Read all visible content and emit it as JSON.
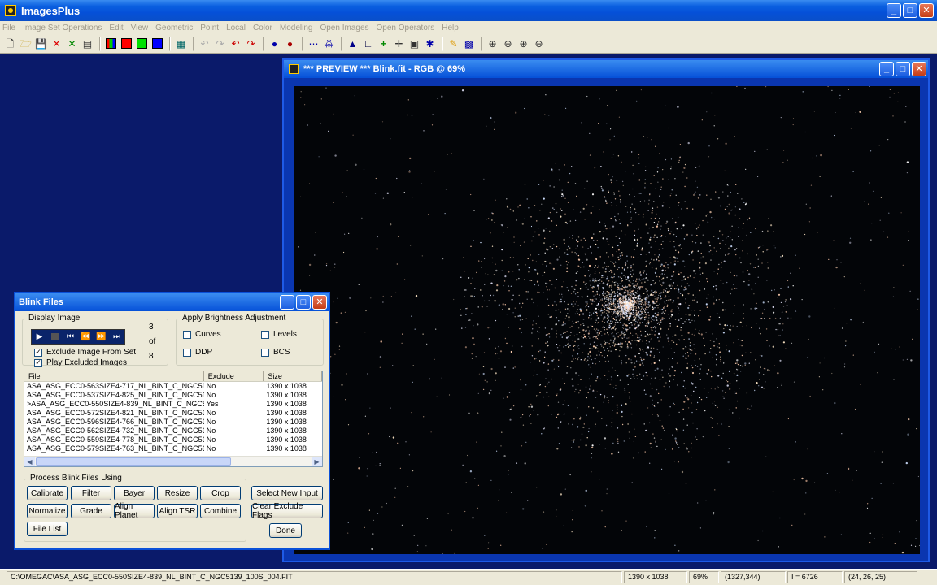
{
  "app": {
    "title": "ImagesPlus"
  },
  "menu": [
    "File",
    "Image Set Operations",
    "Edit",
    "View",
    "Geometric",
    "Point",
    "Local",
    "Color",
    "Modeling",
    "Open Images",
    "Open Operators",
    "Help"
  ],
  "toolbar": {
    "icons": [
      "new-icon",
      "open-icon",
      "save-icon",
      "close-red-icon",
      "close-green-icon",
      "print-icon",
      "rgb-channel-icon",
      "red-channel-icon",
      "green-channel-icon",
      "blue-channel-icon",
      "grid-icon",
      "undo-icon",
      "redo-icon",
      "undo-all-icon",
      "redo-all-icon",
      "point-icon",
      "point-red-icon",
      "dots-icon",
      "star-icon",
      "mountain-icon",
      "angle-icon",
      "plus-icon",
      "crosshair-icon",
      "table-icon",
      "paint-icon",
      "pencil-icon",
      "grid-table-icon",
      "zoom-in-icon",
      "zoom-out-icon",
      "zoom-fit-icon",
      "zoom-actual-icon"
    ],
    "colors": {
      "red": "#ff0000",
      "green": "#00e000",
      "blue": "#0000ff"
    }
  },
  "preview": {
    "title": "*** PREVIEW *** Blink.fit - RGB @ 69%"
  },
  "blink": {
    "title": "Blink Files",
    "display_group": "Display Image",
    "counter": {
      "current": "3",
      "of": "of",
      "total": "8"
    },
    "exclude_label": "Exclude Image From Set",
    "play_excluded_label": "Play Excluded Images",
    "brightness_group": "Apply Brightness Adjustment",
    "curves": "Curves",
    "levels": "Levels",
    "ddp": "DDP",
    "bcs": "BCS",
    "columns": {
      "file": "File",
      "exclude": "Exclude",
      "size": "Size"
    },
    "rows": [
      {
        "file": "ASA_ASG_ECC0-563SIZE4-717_NL_BINT_C_NGC51...",
        "exclude": "No",
        "size": "1390 x 1038"
      },
      {
        "file": "ASA_ASG_ECC0-537SIZE4-825_NL_BINT_C_NGC51...",
        "exclude": "No",
        "size": "1390 x 1038"
      },
      {
        "file": ">ASA_ASG_ECC0-550SIZE4-839_NL_BINT_C_NGC5...",
        "exclude": "Yes",
        "size": "1390 x 1038"
      },
      {
        "file": "ASA_ASG_ECC0-572SIZE4-821_NL_BINT_C_NGC51...",
        "exclude": "No",
        "size": "1390 x 1038"
      },
      {
        "file": "ASA_ASG_ECC0-596SIZE4-766_NL_BINT_C_NGC51...",
        "exclude": "No",
        "size": "1390 x 1038"
      },
      {
        "file": "ASA_ASG_ECC0-562SIZE4-732_NL_BINT_C_NGC51...",
        "exclude": "No",
        "size": "1390 x 1038"
      },
      {
        "file": "ASA_ASG_ECC0-559SIZE4-778_NL_BINT_C_NGC51...",
        "exclude": "No",
        "size": "1390 x 1038"
      },
      {
        "file": "ASA_ASG_ECC0-579SIZE4-763_NL_BINT_C_NGC51...",
        "exclude": "No",
        "size": "1390 x 1038"
      }
    ],
    "process_group": "Process Blink Files Using",
    "buttons": {
      "calibrate": "Calibrate",
      "filter": "Filter",
      "bayer": "Bayer",
      "resize": "Resize",
      "crop": "Crop",
      "normalize": "Normalize",
      "grade": "Grade",
      "align_planet": "Align Planet",
      "align_tsr": "Align TSR",
      "combine": "Combine",
      "file_list": "File List",
      "select_new_input": "Select New Input",
      "clear_exclude_flags": "Clear Exclude Flags",
      "done": "Done"
    }
  },
  "status": {
    "path": "C:\\OMEGAC\\ASA_ASG_ECC0-550SIZE4-839_NL_BINT_C_NGC5139_100S_004.FIT",
    "dimensions": "1390 x 1038",
    "zoom": "69%",
    "coords": "(1327,344)",
    "intensity": "I = 6726",
    "rgb": "(24, 26, 25)"
  }
}
